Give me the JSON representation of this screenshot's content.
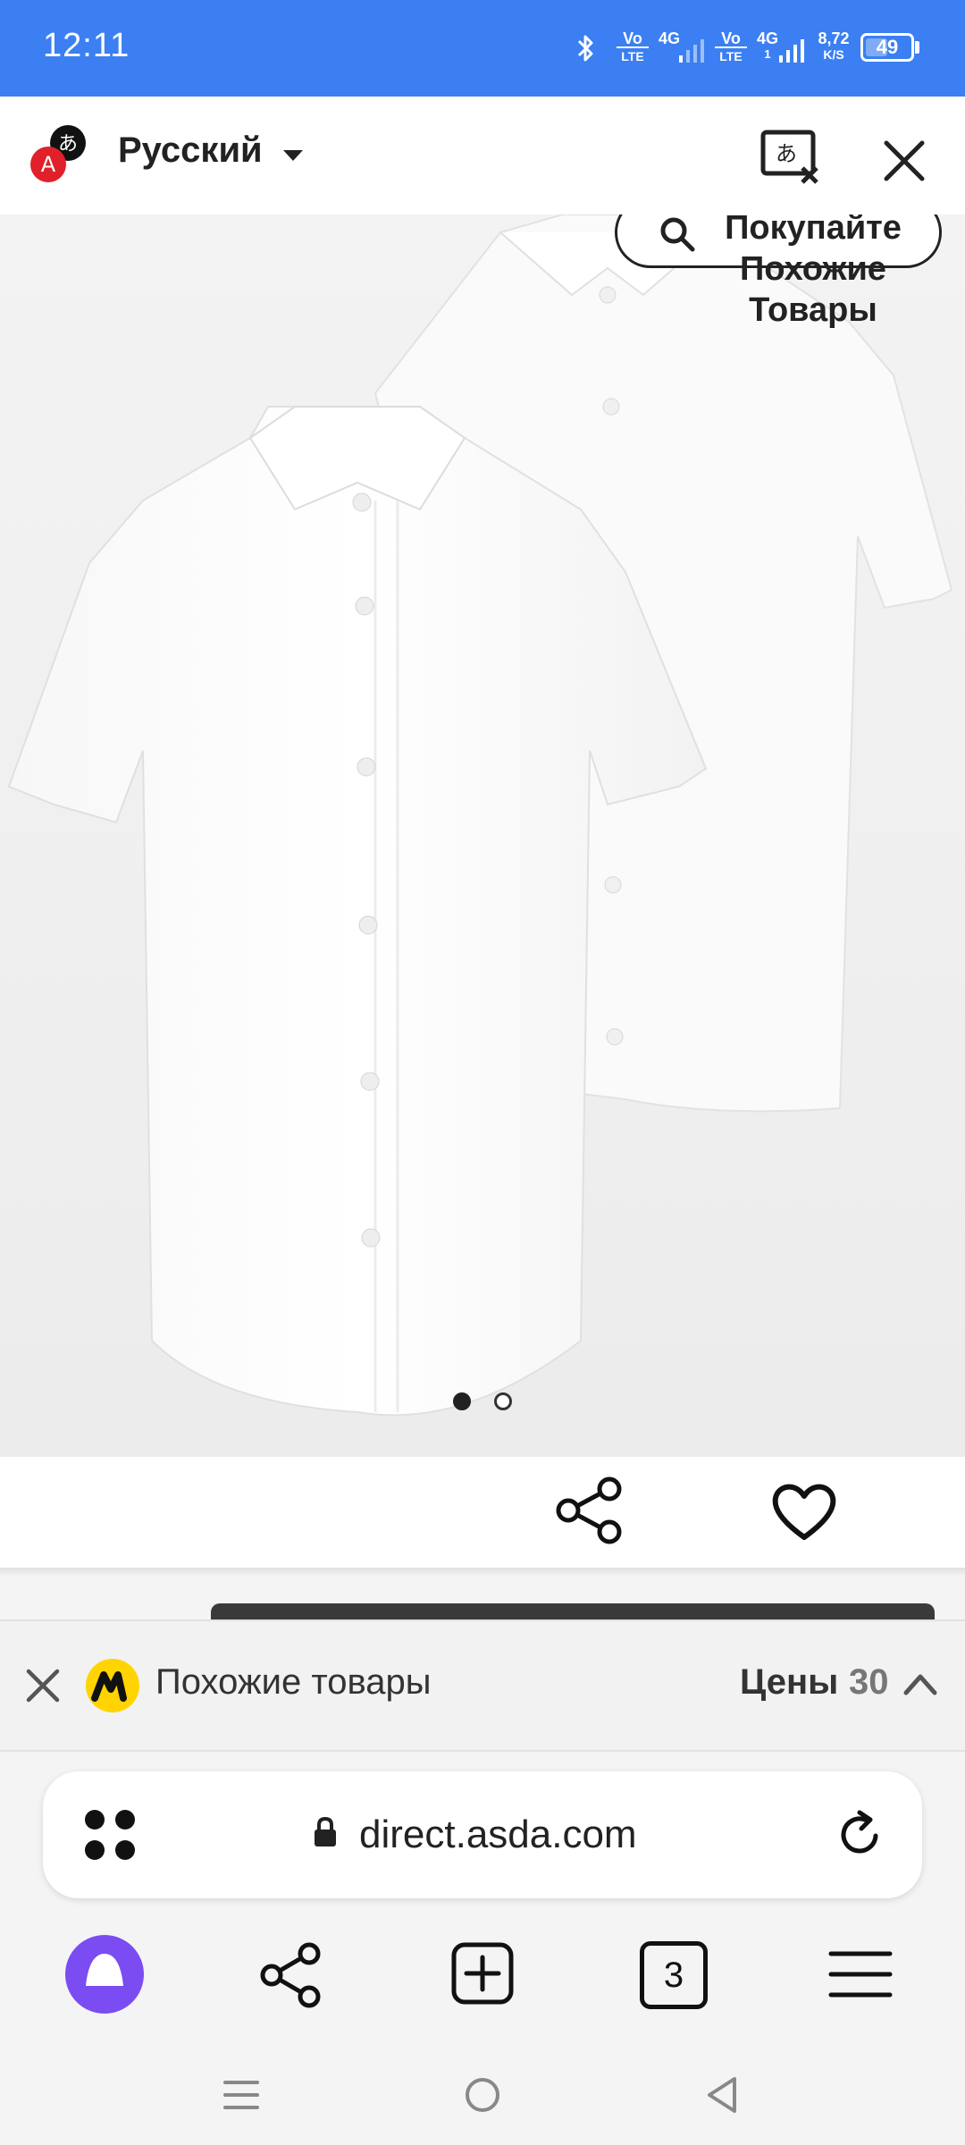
{
  "status_bar": {
    "time": "12:11",
    "net1_top": "Vo",
    "net1_bottom": "LTE",
    "net2": "4G",
    "net3_top": "Vo",
    "net3_bottom": "LTE",
    "net4_top": "4G",
    "net4_bottom": "1",
    "speed_value": "8,72",
    "speed_unit": "K/S",
    "battery": "49",
    "battery_level_percent": 49
  },
  "translate_bar": {
    "language": "Русский"
  },
  "product": {
    "shop_similar_label": "Покупайте Похожие Товары",
    "image_count": 2,
    "active_image_index": 0
  },
  "similar_bar": {
    "label": "Похожие товары",
    "prices_label": "Цены",
    "prices_count": "30"
  },
  "address_bar": {
    "url": "direct.asda.com"
  },
  "bottom_nav": {
    "tabs_count": "3"
  },
  "colors": {
    "status_bar": "#3b7ff2",
    "alice_purple": "#7a4cf2",
    "translate_red": "#e0202a",
    "market_yellow": "#ffd400"
  }
}
